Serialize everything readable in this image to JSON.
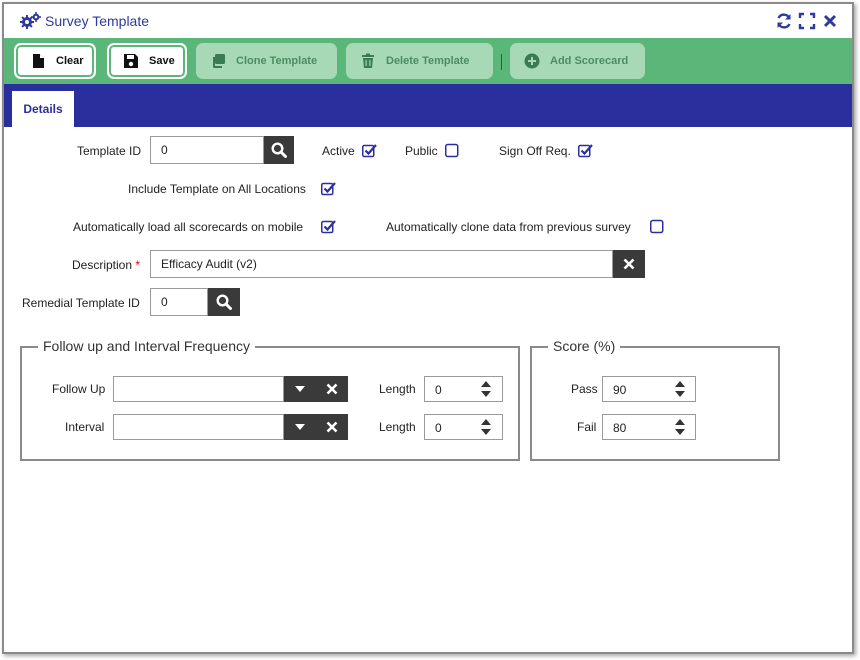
{
  "window": {
    "title": "Survey Template",
    "title_icon": "gears-icon",
    "accent": "#2e3a9c"
  },
  "toolbar": {
    "clear": "Clear",
    "save": "Save",
    "clone": "Clone Template",
    "delete": "Delete Template",
    "add_scorecard": "Add Scorecard",
    "bg": "#5ab779"
  },
  "tabs": [
    {
      "label": "Details",
      "selected": true
    }
  ],
  "form": {
    "template_id": {
      "label": "Template ID",
      "value": "0"
    },
    "active": {
      "label": "Active",
      "checked": true
    },
    "public": {
      "label": "Public",
      "checked": false
    },
    "sign_off": {
      "label": "Sign Off Req.",
      "checked": true
    },
    "include_all": {
      "label": "Include Template on All Locations",
      "checked": true
    },
    "auto_load": {
      "label": "Automatically load all scorecards on mobile",
      "checked": true
    },
    "auto_clone": {
      "label": "Automatically clone data from previous survey",
      "checked": false
    },
    "description": {
      "label": "Description",
      "required_mark": "*",
      "value": "Efficacy Audit (v2)"
    },
    "remedial": {
      "label": "Remedial Template ID",
      "value": "0"
    }
  },
  "followup": {
    "legend": "Follow up and Interval Frequency",
    "follow_up": {
      "label": "Follow Up",
      "value": ""
    },
    "follow_length": {
      "label": "Length",
      "value": "0"
    },
    "interval": {
      "label": "Interval",
      "value": ""
    },
    "interval_length": {
      "label": "Length",
      "value": "0"
    }
  },
  "score": {
    "legend": "Score (%)",
    "pass": {
      "label": "Pass",
      "value": "90"
    },
    "fail": {
      "label": "Fail",
      "value": "80"
    }
  }
}
